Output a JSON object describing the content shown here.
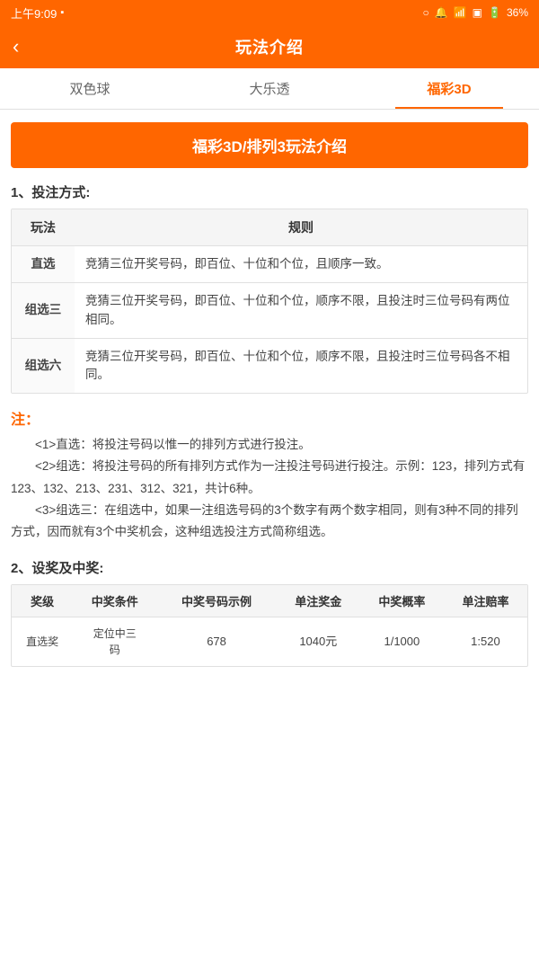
{
  "statusBar": {
    "time": "上午9:09",
    "battery": "36%"
  },
  "header": {
    "backLabel": "‹",
    "title": "玩法介绍"
  },
  "tabs": [
    {
      "id": "tab1",
      "label": "双色球",
      "active": false
    },
    {
      "id": "tab2",
      "label": "大乐透",
      "active": false
    },
    {
      "id": "tab3",
      "label": "福彩3D",
      "active": true
    }
  ],
  "banner": {
    "text": "福彩3D/排列3玩法介绍"
  },
  "section1": {
    "title": "1、投注方式:",
    "tableHeaders": [
      "玩法",
      "规则"
    ],
    "rows": [
      {
        "play": "直选",
        "rule": "竞猜三位开奖号码，即百位、十位和个位，且顺序一致。"
      },
      {
        "play": "组选三",
        "rule": "竞猜三位开奖号码，即百位、十位和个位，顺序不限，且投注时三位号码有两位相同。"
      },
      {
        "play": "组选六",
        "rule": "竞猜三位开奖号码，即百位、十位和个位，顺序不限，且投注时三位号码各不相同。"
      }
    ]
  },
  "notes": {
    "label": "注：",
    "items": [
      "<1>直选：将投注号码以惟一的排列方式进行投注。",
      "<2>组选：将投注号码的所有排列方式作为一注投注号码进行投注。示例：123，排列方式有123、132、213、231、312、321，共计6种。",
      "<3>组选三：在组选中，如果一注组选号码的3个数字有两个数字相同，则有3种不同的排列方式，因而就有3个中奖机会，这种组选投注方式简称组选。"
    ]
  },
  "section2": {
    "title": "2、设奖及中奖:",
    "tableHeaders": [
      "奖级",
      "中奖条件",
      "中奖号码示例",
      "单注奖金",
      "中奖概率",
      "单注赔率"
    ],
    "rows": [
      {
        "level": "直选奖",
        "condition": "定位中三码",
        "example": "678",
        "prize": "1040元",
        "probability": "1/1000",
        "ratio": "1:520"
      }
    ]
  }
}
